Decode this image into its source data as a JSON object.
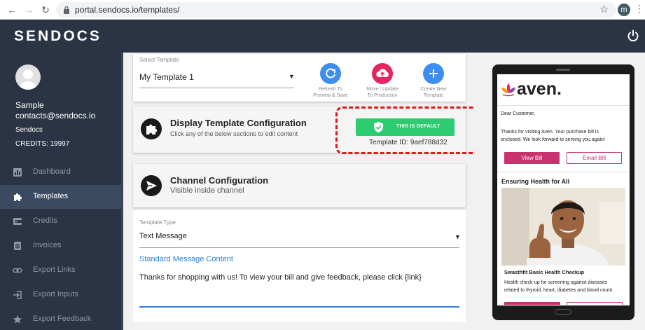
{
  "browser": {
    "url": "portal.sendocs.io/templates/",
    "profile_initial": "m"
  },
  "app": {
    "brand": "SENDOCS"
  },
  "user": {
    "name": "Sample",
    "email": "contacts@sendocs.io",
    "org": "Sendocs",
    "credits": "CREDITS: 19997"
  },
  "sidebar": {
    "items": [
      {
        "label": "Dashboard",
        "icon": "dashboard-icon",
        "active": false
      },
      {
        "label": "Templates",
        "icon": "puzzle-icon",
        "active": true
      },
      {
        "label": "Credits",
        "icon": "wallet-icon",
        "active": false
      },
      {
        "label": "Invoices",
        "icon": "invoice-icon",
        "active": false
      },
      {
        "label": "Export Links",
        "icon": "link-icon",
        "active": false
      },
      {
        "label": "Export Inputs",
        "icon": "export-icon",
        "active": false
      },
      {
        "label": "Export Feedback",
        "icon": "star-icon",
        "active": false
      }
    ]
  },
  "template_select": {
    "label": "Select Template",
    "value": "My Template 1"
  },
  "actions": [
    {
      "label_line1": "Refresh To",
      "label_line2": "Preview & Save",
      "color": "#3d8ef0",
      "icon": "refresh-icon"
    },
    {
      "label_line1": "Move / Update",
      "label_line2": "To Production",
      "color": "#e8245f",
      "icon": "cloud-upload-icon"
    },
    {
      "label_line1": "Create New",
      "label_line2": "Template",
      "color": "#3d8ef0",
      "icon": "plus-icon"
    }
  ],
  "display_config": {
    "title": "Display Template Configuration",
    "subtitle": "Click any of the below sections to edit content",
    "default_label": "THIS IS DEFAULT",
    "template_id": "Template ID: 9aef788d32",
    "default_color": "#2ecc71",
    "highlight_color": "#e01919"
  },
  "channel_config": {
    "title": "Channel Configuration",
    "subtitle": "Visible inside channel"
  },
  "template_type": {
    "label": "Template Type",
    "value": "Text Message"
  },
  "message": {
    "heading": "Standard Message Content",
    "body": "Thanks for shopping with us! To view your bill and give feedback, please click {link}"
  },
  "preview": {
    "brand": "aven.",
    "greeting": "Dear Customer,",
    "body_line1": "Thanks for visiting Aven. Your purchase bill is",
    "body_line2": "enclosed. We look forward to serving you again!",
    "view_bill": "View Bill",
    "email_bill": "Email Bill",
    "section_title": "Ensuring Health for All",
    "card_title": "Swasthfit Basic Health Checkup",
    "card_line1": "Health check-up for screening against diseases",
    "card_line2": "related to thyroid, heart, diabetes and blood count.",
    "accent_color": "#c8326e"
  }
}
